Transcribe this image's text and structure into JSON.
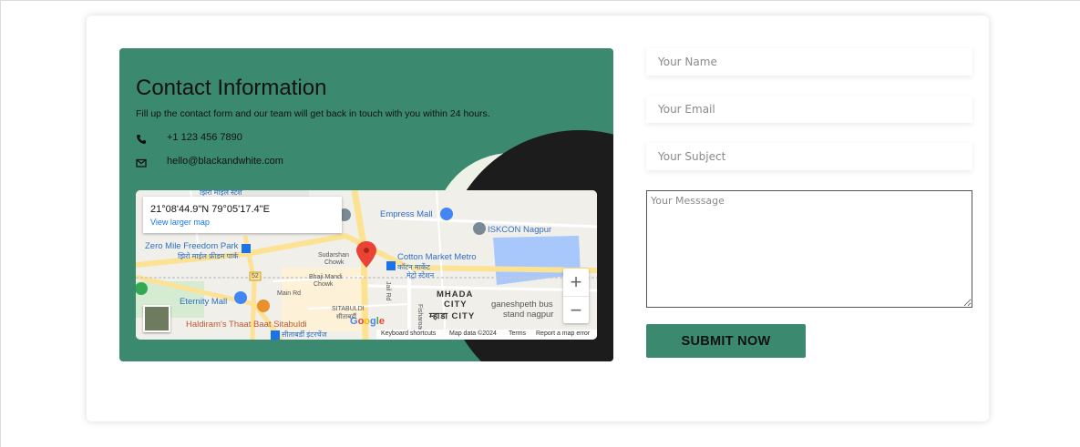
{
  "contact": {
    "title": "Contact Information",
    "subtitle": "Fill up the contact form and our team will get back in touch with you within 24 hours.",
    "phone": "+1 123 456 7890",
    "email": "hello@blackandwhite.com",
    "icons": {
      "phone": "phone-icon",
      "email": "envelope-icon"
    },
    "colors": {
      "panel": "#3b8a6f",
      "dark_blob": "#1c1c1c",
      "light_blob": "#eef2e6"
    }
  },
  "map": {
    "coordinates": "21°08'44.9\"N 79°05'17.4\"E",
    "larger_map_link": "View larger map",
    "zoom_in": "+",
    "zoom_out": "−",
    "google_logo": "Google",
    "footer": {
      "shortcuts": "Keyboard shortcuts",
      "data": "Map data ©2024",
      "terms": "Terms",
      "report": "Report a map error"
    },
    "labels": {
      "empress_mall": "Empress Mall",
      "iskcon": "ISKCON Nagpur",
      "zero_mile": "Zero Mile Freedom Park",
      "zero_mile_hi": "झिरो माईल फ्रीडम पार्क",
      "cotton_market": "Cotton Market Metro",
      "cotton_market_hi1": "कॉटन मार्केट",
      "cotton_market_hi2": "मेट्रो स्टेशन",
      "sudarshan": "Sudarshan",
      "chowk": "Chowk",
      "bhaji_mandi": "Bhaji Mandi",
      "bhaji_chowk": "Chowk",
      "eternity": "Eternity Mall",
      "main_rd": "Main Rd",
      "jail_rd": "Jail Rd",
      "mhada": "MHADA",
      "city": "CITY",
      "mhada_hi": "म्हाडा CITY",
      "ganeshpeth": "ganeshpeth bus",
      "stand": "stand nagpur",
      "haldiram": "Haldiram's Thaat Baat Sitabuldi",
      "sitabuldi": "SITABULDI",
      "sitabuldi_hi": "सीताबर्डी",
      "top_hi": "झिरो माईल स्टेश",
      "bottom_hi": "सीताबर्डी इंटरचेंज",
      "route_52": "52",
      "neuro": "Fisharoad"
    },
    "colors": {
      "water": "#a8c7fa",
      "road_major": "#fde293",
      "road": "#ffffff",
      "pin": "#ea4335"
    }
  },
  "form": {
    "name_placeholder": "Your Name",
    "email_placeholder": "Your Email",
    "subject_placeholder": "Your Subject",
    "message_placeholder": "Your Messsage",
    "submit_label": "SUBMIT NOW",
    "colors": {
      "submit": "#3b8a6f"
    }
  }
}
